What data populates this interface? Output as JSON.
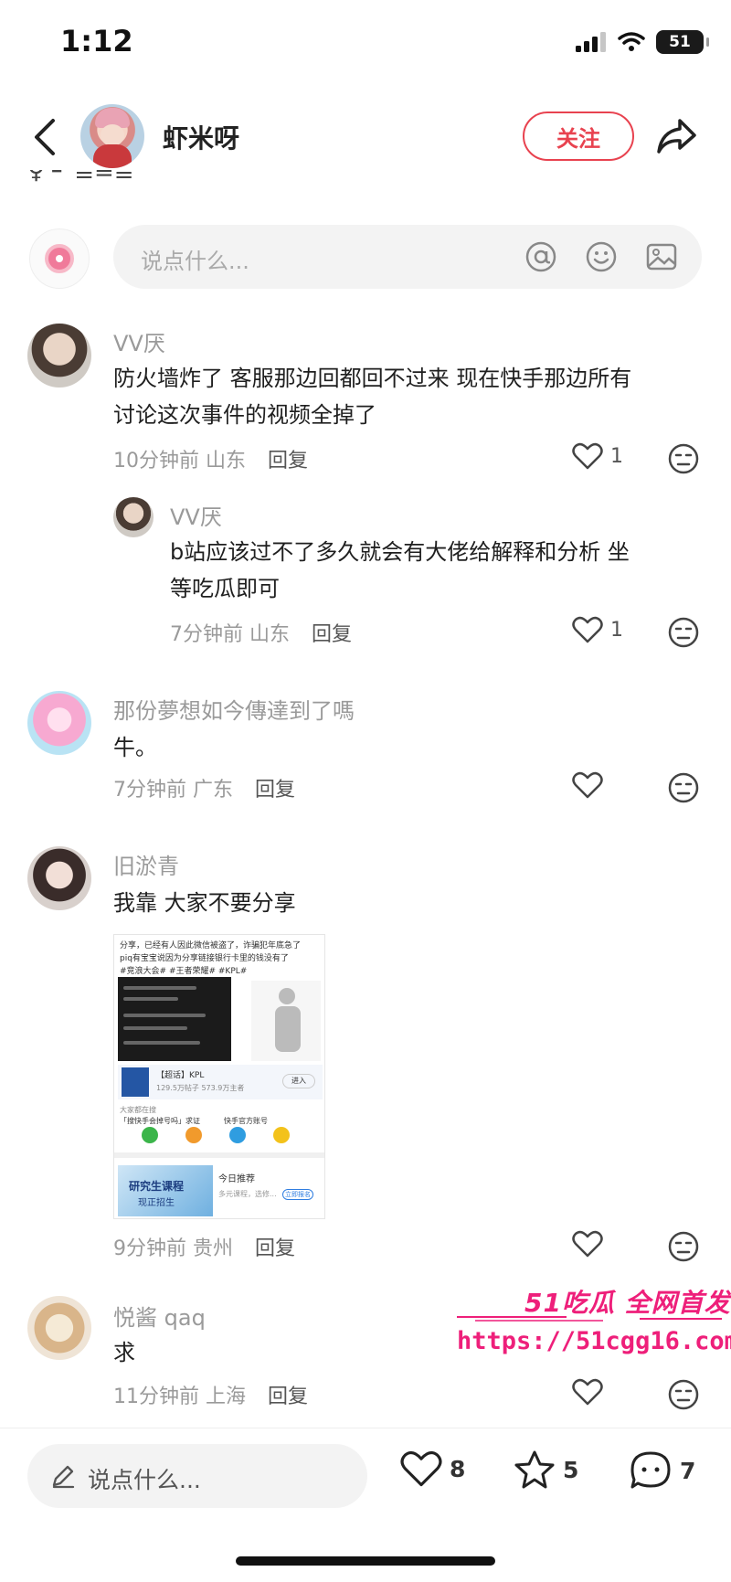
{
  "status_bar": {
    "time": "1:12",
    "battery": "51"
  },
  "header": {
    "username": "虾米呀",
    "follow_label": "关注"
  },
  "top_input": {
    "placeholder": "说点什么..."
  },
  "comments": [
    {
      "name": "VV厌",
      "text_lines": [
        "防火墙炸了 客服那边回都回不过来 现在快手那边所有",
        "讨论这次事件的视频全掉了"
      ],
      "time": "10分钟前",
      "location": "山东",
      "reply_label": "回复",
      "likes": "1"
    },
    {
      "name": "VV厌",
      "text_lines": [
        "b站应该过不了多久就会有大佬给解释和分析 坐",
        "等吃瓜即可"
      ],
      "time": "7分钟前",
      "location": "山东",
      "reply_label": "回复",
      "likes": "1"
    },
    {
      "name": "那份夢想如今傳達到了嗎",
      "text_lines": [
        "牛。"
      ],
      "time": "7分钟前",
      "location": "广东",
      "reply_label": "回复",
      "likes": ""
    },
    {
      "name": "旧淤青",
      "text_lines": [
        "我靠 大家不要分享"
      ],
      "time": "9分钟前",
      "location": "贵州",
      "reply_label": "回复",
      "likes": ""
    },
    {
      "name": "悦酱 qaq",
      "text_lines": [
        "求"
      ],
      "time": "11分钟前",
      "location": "上海",
      "reply_label": "回复",
      "likes": ""
    }
  ],
  "embedded_screenshot": {
    "lines": [
      "分享，已经有人因此微信被盗了，诈骗犯年底急了",
      "piq有宝宝说因为分享链接银行卡里的钱没有了",
      "#竞浪大会# #王者荣耀# #KPL#"
    ],
    "kpl_label": "【超话】KPL",
    "kpl_sub": "129.5万帖子 573.9万主者",
    "enter_label": "进入",
    "people_label": "大家都在搜",
    "search1": "「搜快手会掉号吗」求证",
    "search2": "快手官方账号",
    "ad_title": "研究生课程",
    "ad_sub": "现正招生",
    "ad_right_title": "今日推荐",
    "ad_right_sub": "多元课程，选修...",
    "ad_right_btn": "立即报名"
  },
  "watermark": {
    "brand": "51吃瓜 全网首发",
    "url": "https://51cgg16.com"
  },
  "bottom_bar": {
    "placeholder": "说点什么...",
    "likes": "8",
    "stars": "5",
    "comments": "7"
  },
  "colors": {
    "accent": "#e8424f",
    "watermark": "#ee1f7a",
    "meta_gray": "#9a9a9a"
  },
  "icons": [
    "back-arrow-icon",
    "share-icon",
    "at-icon",
    "emoji-icon",
    "image-icon",
    "heart-icon",
    "dislike-icon",
    "pen-icon",
    "star-icon",
    "comment-bubble-icon"
  ]
}
